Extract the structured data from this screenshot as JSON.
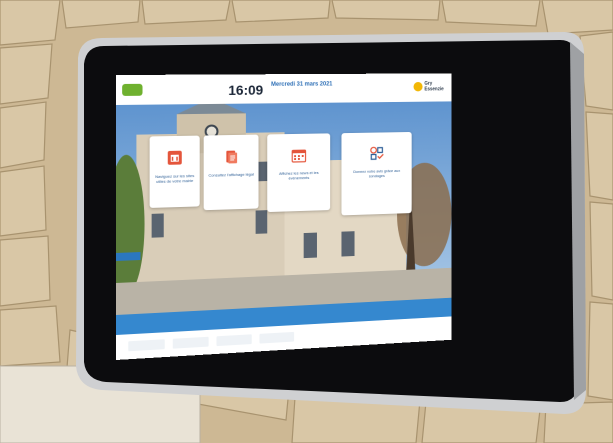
{
  "kiosk": {
    "clock": "16:09",
    "date": "Mercredi 31 mars 2021",
    "brand_lines": [
      "Gry",
      "Essenzie"
    ],
    "tiles": [
      {
        "icon": "municipal-building-icon",
        "label": "Naviguez sur les sites utiles de votre mairie"
      },
      {
        "icon": "document-display-icon",
        "label": "Consultez l'affichage légal"
      },
      {
        "icon": "calendar-icon",
        "label": "Affichez les news et les évènements"
      },
      {
        "icon": "survey-checklist-icon",
        "label": "Donnez votre avis grâce aux sondages"
      }
    ]
  },
  "colors": {
    "accent_blue": "#3588cf",
    "tile_text": "#2a5c94",
    "screen_bg": "#ffffff",
    "bezel": "#0c0c0e",
    "frame": "#c9c9c9"
  }
}
